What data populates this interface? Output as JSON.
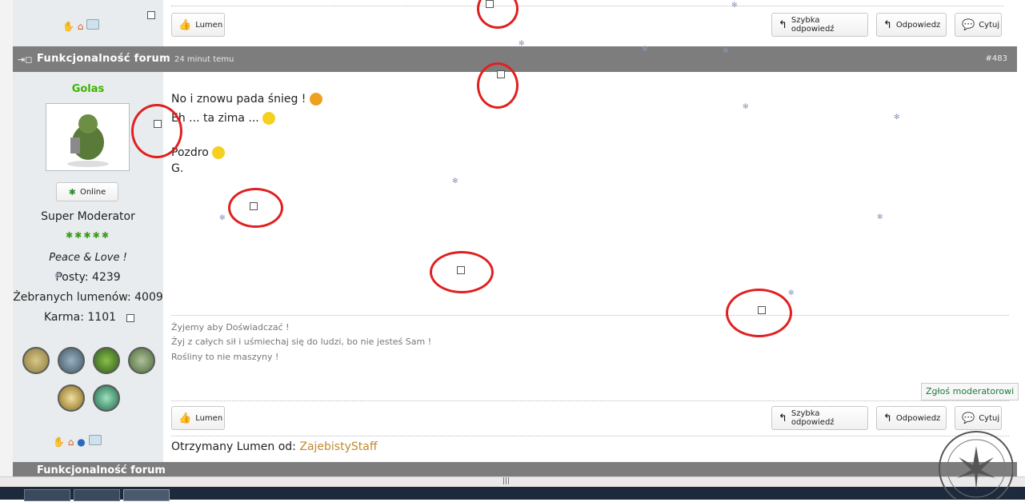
{
  "post_top": {
    "lumen_label": "Lumen",
    "quick_reply_label": "Szybka odpowiedź",
    "reply_label": "Odpowiedz",
    "quote_label": "Cytuj"
  },
  "post": {
    "title": "Funkcjonalność forum",
    "time": "24 minut temu",
    "number": "#483",
    "author": {
      "name": "Golas",
      "status": "Online",
      "rank": "Super Moderator",
      "motto": "Peace & Love !",
      "posts": "Posty: 4239",
      "lumens": "Żebranych lumenów: 4009",
      "karma": "Karma: 1101"
    },
    "body_lines": [
      "No i znowu pada śnieg !",
      "Eh ... ta zima ...",
      "Pozdro",
      "G."
    ],
    "signature_lines": [
      "Żyjemy aby Doświadczać !",
      "Żyj z całych sił i uśmiechaj się do ludzi, bo nie jesteś Sam !",
      "Rośliny to nie maszyny !"
    ],
    "report_label": "Zgłoś moderatorowi",
    "lumen_label": "Lumen",
    "quick_reply_label": "Szybka odpowiedź",
    "reply_label": "Odpowiedz",
    "quote_label": "Cytuj",
    "received_label": "Otrzymany Lumen od:",
    "received_from": "ZajebistyStaff"
  },
  "next_post": {
    "title": "Funkcjonalność forum"
  },
  "colors": {
    "header_bar": "#7d7d7d",
    "sidebar_bg": "#e9ecee",
    "author_name": "#3bb400",
    "link": "#c08a2b",
    "report_link": "#1a7a3a",
    "annotation_red": "#e02020"
  },
  "icons": [
    "thumbs-up-icon",
    "reply-arrow-icon",
    "quote-bubble-icon",
    "cannabis-leaf-icon",
    "home-icon",
    "globe-icon",
    "message-icon",
    "snowflake-icon",
    "badge-icon"
  ]
}
